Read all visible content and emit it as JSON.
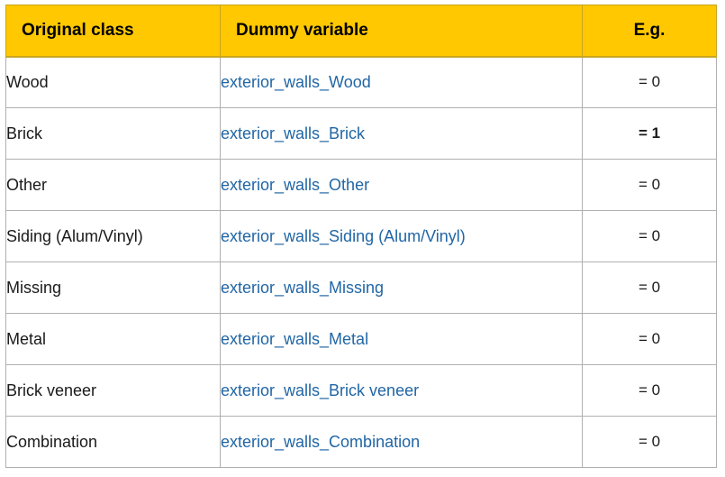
{
  "table": {
    "columns": [
      {
        "key": "original_class",
        "label": "Original class",
        "align": "left"
      },
      {
        "key": "dummy_variable",
        "label": "Dummy variable",
        "align": "left"
      },
      {
        "key": "example",
        "label": "E.g.",
        "align": "center"
      }
    ],
    "header_background": "#ffc800",
    "header_text_color": "#000000",
    "dummy_text_color": "#2166a5",
    "border_color": "#b0b0b0",
    "rows": [
      {
        "original_class": "Wood",
        "dummy_variable": "exterior_walls_Wood",
        "example": "= 0",
        "highlighted": false
      },
      {
        "original_class": "Brick",
        "dummy_variable": "exterior_walls_Brick",
        "example": "= 1",
        "highlighted": true
      },
      {
        "original_class": "Other",
        "dummy_variable": "exterior_walls_Other",
        "example": "= 0",
        "highlighted": false
      },
      {
        "original_class": "Siding (Alum/Vinyl)",
        "dummy_variable": "exterior_walls_Siding (Alum/Vinyl)",
        "example": "= 0",
        "highlighted": false
      },
      {
        "original_class": "Missing",
        "dummy_variable": "exterior_walls_Missing",
        "example": "= 0",
        "highlighted": false
      },
      {
        "original_class": "Metal",
        "dummy_variable": "exterior_walls_Metal",
        "example": "= 0",
        "highlighted": false
      },
      {
        "original_class": "Brick veneer",
        "dummy_variable": "exterior_walls_Brick veneer",
        "example": "= 0",
        "highlighted": false
      },
      {
        "original_class": "Combination",
        "dummy_variable": "exterior_walls_Combination",
        "example": "= 0",
        "highlighted": false
      }
    ]
  }
}
